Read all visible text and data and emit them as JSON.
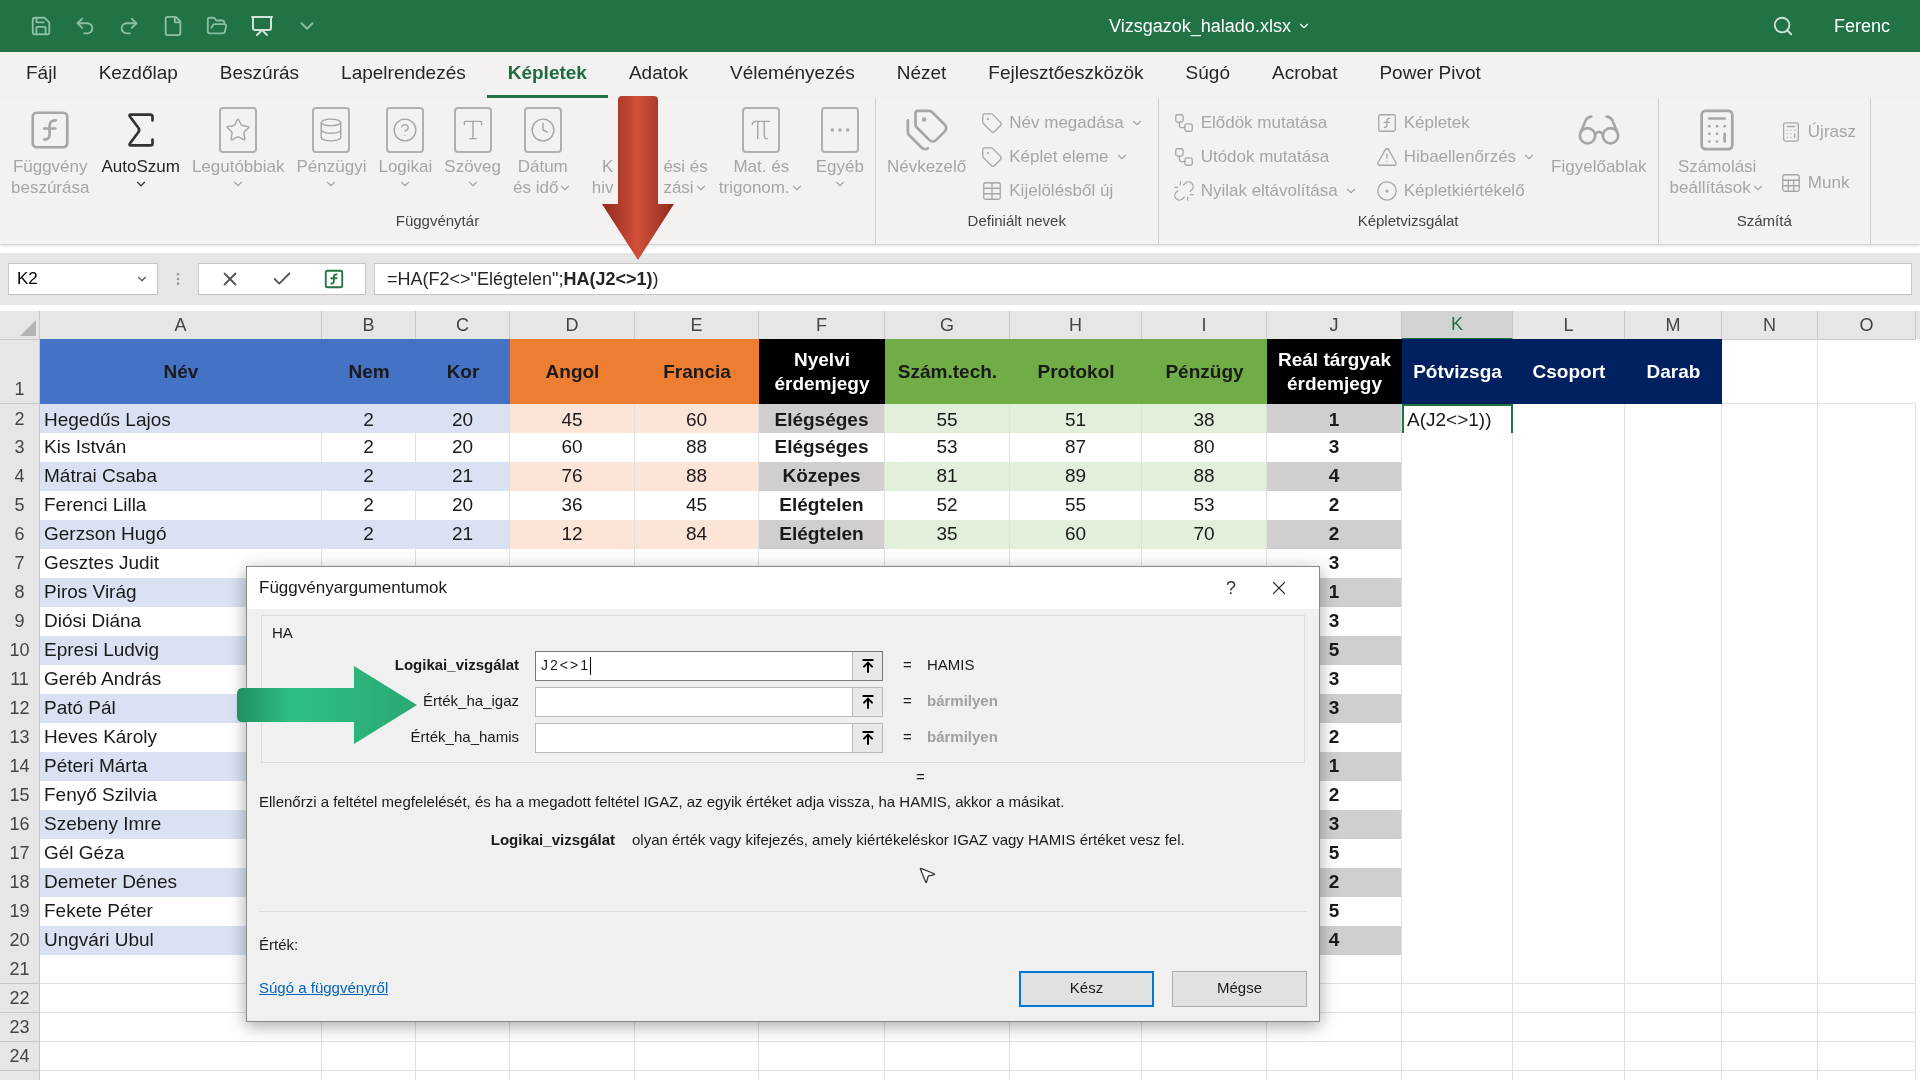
{
  "title_bar": {
    "file_name": "Vizsgazok_halado.xlsx",
    "user": "Ferenc"
  },
  "tabs": [
    {
      "label": "Fájl",
      "selected": false
    },
    {
      "label": "Kezdőlap",
      "selected": false
    },
    {
      "label": "Beszúrás",
      "selected": false
    },
    {
      "label": "Lapelrendezés",
      "selected": false
    },
    {
      "label": "Képletek",
      "selected": true
    },
    {
      "label": "Adatok",
      "selected": false
    },
    {
      "label": "Véleményezés",
      "selected": false
    },
    {
      "label": "Nézet",
      "selected": false
    },
    {
      "label": "Fejlesztőeszközök",
      "selected": false
    },
    {
      "label": "Súgó",
      "selected": false
    },
    {
      "label": "Acrobat",
      "selected": false
    },
    {
      "label": "Power Pivot",
      "selected": false
    }
  ],
  "ribbon": {
    "groups": [
      {
        "label": "Függvénytár",
        "items": [
          {
            "kind": "large",
            "lines": [
              "Függvény",
              "beszúrása"
            ],
            "disabled": true,
            "dropdown": false
          },
          {
            "kind": "large",
            "lines": [
              "AutoSzum"
            ],
            "disabled": false,
            "dropdown": true
          },
          {
            "kind": "large",
            "lines": [
              "Legutóbbiak"
            ],
            "disabled": true,
            "dropdown": true
          },
          {
            "kind": "large",
            "lines": [
              "Pénzügyi"
            ],
            "disabled": true,
            "dropdown": true
          },
          {
            "kind": "large",
            "lines": [
              "Logikai"
            ],
            "disabled": true,
            "dropdown": true
          },
          {
            "kind": "large",
            "lines": [
              "Szöveg"
            ],
            "disabled": true,
            "dropdown": true
          },
          {
            "kind": "large",
            "lines": [
              "Dátum",
              "és idő"
            ],
            "disabled": true,
            "dropdown": true
          },
          {
            "kind": "covered",
            "parts": [
              [
                "K",
                "ési és"
              ],
              [
                "hiv",
                "zási"
              ]
            ],
            "disabled": true,
            "dropdown": true
          },
          {
            "kind": "large",
            "lines": [
              "Mat. és",
              "trigonom."
            ],
            "disabled": true,
            "dropdown": true
          },
          {
            "kind": "large",
            "lines": [
              "Egyéb"
            ],
            "disabled": true,
            "dropdown": true
          }
        ]
      },
      {
        "label": "Definiált nevek",
        "items": [
          {
            "kind": "large",
            "lines": [
              "Névkezelő"
            ],
            "disabled": true,
            "dropdown": false
          },
          {
            "kind": "small",
            "label": "Név megadása",
            "disabled": true,
            "dropdown": true
          },
          {
            "kind": "small",
            "label": "Képlet eleme",
            "disabled": true,
            "dropdown": true
          },
          {
            "kind": "small",
            "label": "Kijelölésből új",
            "disabled": true,
            "dropdown": false
          }
        ]
      },
      {
        "label": "Képletvizsgálat",
        "items": [
          {
            "kind": "small",
            "label": "Elődök mutatása",
            "disabled": true,
            "dropdown": false
          },
          {
            "kind": "small",
            "label": "Utódok mutatása",
            "disabled": true,
            "dropdown": false
          },
          {
            "kind": "small",
            "label": "Nyilak eltávolítása",
            "disabled": true,
            "dropdown": true
          },
          {
            "kind": "small",
            "label": "Képletek",
            "disabled": true,
            "dropdown": false
          },
          {
            "kind": "small",
            "label": "Hibaellenőrzés",
            "disabled": true,
            "dropdown": true
          },
          {
            "kind": "small",
            "label": "Képletkiértékelő",
            "disabled": true,
            "dropdown": false
          },
          {
            "kind": "large",
            "lines": [
              "Figyelőablak"
            ],
            "disabled": true,
            "dropdown": false
          }
        ]
      },
      {
        "label": "Számítá",
        "items": [
          {
            "kind": "large",
            "lines": [
              "Számolási",
              "beállítások"
            ],
            "disabled": true,
            "dropdown": true
          },
          {
            "kind": "small",
            "label": "Újrasz",
            "disabled": true,
            "dropdown": false
          },
          {
            "kind": "small",
            "label": "Munk",
            "disabled": true,
            "dropdown": false
          }
        ]
      }
    ]
  },
  "formula_bar": {
    "name_box": "K2",
    "formula": "=HA(F2<>\"Elégtelen\";**HA(J2<>1)**)"
  },
  "sheet": {
    "columns": [
      {
        "letter": "A",
        "selected": false
      },
      {
        "letter": "B",
        "selected": false
      },
      {
        "letter": "C",
        "selected": false
      },
      {
        "letter": "D",
        "selected": false
      },
      {
        "letter": "E",
        "selected": false
      },
      {
        "letter": "F",
        "selected": false
      },
      {
        "letter": "G",
        "selected": false
      },
      {
        "letter": "H",
        "selected": false
      },
      {
        "letter": "I",
        "selected": false
      },
      {
        "letter": "J",
        "selected": false
      },
      {
        "letter": "K",
        "selected": true
      },
      {
        "letter": "L",
        "selected": false
      },
      {
        "letter": "M",
        "selected": false
      },
      {
        "letter": "N",
        "selected": false
      },
      {
        "letter": "O",
        "selected": false
      }
    ],
    "header_row": "1",
    "header": [
      {
        "text": "Név",
        "color": "#4472c4"
      },
      {
        "text": "Nem",
        "color": "#4472c4"
      },
      {
        "text": "Kor",
        "color": "#4472c4"
      },
      {
        "text": "Angol",
        "color": "#ed7d31"
      },
      {
        "text": "Francia",
        "color": "#ed7d31"
      },
      {
        "text": "Nyelvi érdemjegy",
        "color": "#000000"
      },
      {
        "text": "Szám.tech.",
        "color": "#70ad47"
      },
      {
        "text": "Protokol",
        "color": "#70ad47"
      },
      {
        "text": "Pénzügy",
        "color": "#70ad47"
      },
      {
        "text": "Reál tárgyak érdemjegy",
        "color": "#000000"
      },
      {
        "text": "Pótvizsga",
        "color": "#002060"
      },
      {
        "text": "Csoport",
        "color": "#002060"
      },
      {
        "text": "Darab",
        "color": "#002060"
      }
    ],
    "rows": [
      {
        "number": "2",
        "name": "Hegedűs Lajos",
        "scores": [
          "2",
          "20",
          "45",
          "60",
          "Elégséges",
          "55",
          "51",
          "38"
        ],
        "grade": "1",
        "k": {
          "text": "A(J2<>1))",
          "selected": true
        }
      },
      {
        "number": "3",
        "name": "Kis István",
        "scores": [
          "2",
          "20",
          "60",
          "88",
          "Elégséges",
          "53",
          "87",
          "80"
        ],
        "grade": "3"
      },
      {
        "number": "4",
        "name": "Mátrai Csaba",
        "scores": [
          "2",
          "21",
          "76",
          "88",
          "Közepes",
          "81",
          "89",
          "88"
        ],
        "grade": "4"
      },
      {
        "number": "5",
        "name": "Ferenci Lilla",
        "scores": [
          "2",
          "20",
          "36",
          "45",
          "Elégtelen",
          "52",
          "55",
          "53"
        ],
        "grade": "2"
      },
      {
        "number": "6",
        "name": "Gerzson Hugó",
        "scores": [
          "2",
          "21",
          "12",
          "84",
          "Elégtelen",
          "35",
          "60",
          "70"
        ],
        "grade": "2"
      },
      {
        "number": "7",
        "name": "Gesztes Judit",
        "grade": "3"
      },
      {
        "number": "8",
        "name": "Piros Virág",
        "grade": "1"
      },
      {
        "number": "9",
        "name": "Diósi Diána",
        "grade": "3"
      },
      {
        "number": "10",
        "name": "Epresi Ludvig",
        "grade": "5"
      },
      {
        "number": "11",
        "name": "Geréb András",
        "grade": "3"
      },
      {
        "number": "12",
        "name": "Pató Pál",
        "grade": "3"
      },
      {
        "number": "13",
        "name": "Heves Károly",
        "grade": "2"
      },
      {
        "number": "14",
        "name": "Péteri Márta",
        "grade": "1"
      },
      {
        "number": "15",
        "name": "Fenyő Szilvia",
        "grade": "2"
      },
      {
        "number": "16",
        "name": "Szebeny Imre",
        "grade": "3"
      },
      {
        "number": "17",
        "name": "Gél Géza",
        "grade": "5"
      },
      {
        "number": "18",
        "name": "Demeter Dénes",
        "grade": "2"
      },
      {
        "number": "19",
        "name": "Fekete Péter",
        "grade": "5"
      },
      {
        "number": "20",
        "name": "Ungvári Ubul",
        "grade": "4"
      },
      {
        "number": "21"
      },
      {
        "number": "22"
      },
      {
        "number": "23"
      },
      {
        "number": "24"
      }
    ]
  },
  "dialog": {
    "title": "Függvényargumentumok",
    "help": "?",
    "function": "HA",
    "arguments": [
      {
        "label": "Logikai_vizsgálat",
        "required": true,
        "value": "J2<>1",
        "focused": true,
        "equals": "=",
        "result": "HAMIS",
        "greyed": false
      },
      {
        "label": "Érték_ha_igaz",
        "required": false,
        "focused": false,
        "equals": "=",
        "result": "bármilyen",
        "greyed": true
      },
      {
        "label": "Érték_ha_hamis",
        "required": false,
        "focused": false,
        "equals": "=",
        "result": "bármilyen",
        "greyed": true
      }
    ],
    "result_equals": "=",
    "description": "Ellenőrzi a feltétel megfelelését, és ha a megadott feltétel IGAZ, az egyik értéket adja vissza, ha HAMIS, akkor a  másikat.",
    "arg_name": "Logikai_vizsgálat",
    "arg_description": "olyan érték vagy kifejezés, amely kiértékeléskor IGAZ vagy HAMIS értéket vesz fel.",
    "value_label": "Érték:",
    "help_link": "Súgó a függvényről",
    "buttons": [
      {
        "label": "Kész",
        "default": true
      },
      {
        "label": "Mégse",
        "default": false
      }
    ]
  }
}
